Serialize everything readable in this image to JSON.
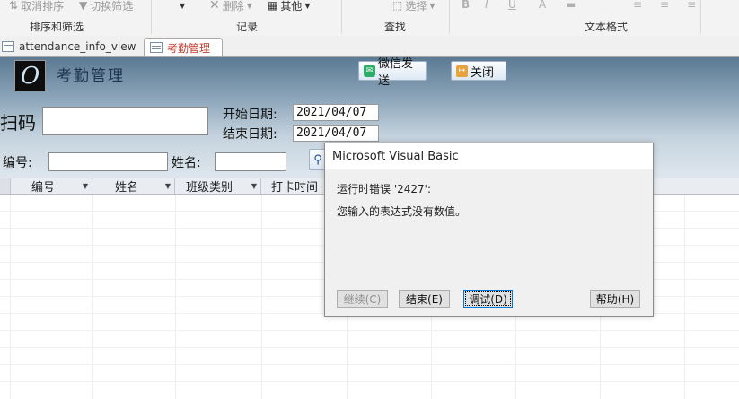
{
  "ribbon": {
    "sort_filter": {
      "cancel_sort": "取消排序",
      "toggle_filter": "切换筛选",
      "group_label": "排序和筛选"
    },
    "records": {
      "delete": "删除",
      "other": "其他",
      "group_label": "记录"
    },
    "find": {
      "select": "选择",
      "group_label": "查找"
    },
    "text_format": {
      "bold": "B",
      "italic": "I",
      "underline": "U",
      "group_label": "文本格式"
    }
  },
  "tabs": [
    {
      "label": "attendance_info_view",
      "active": false,
      "icon": "table-icon"
    },
    {
      "label": "考勤管理",
      "active": true,
      "icon": "form-icon"
    }
  ],
  "form": {
    "title": "考勤管理",
    "logo_letter": "O",
    "wechat_button": "微信发送",
    "close_button": "关闭",
    "scan_label": "扫码",
    "scan_value": "",
    "start_date_label": "开始日期:",
    "start_date_value": "2021/04/07",
    "end_date_label": "结束日期:",
    "end_date_value": "2021/04/07",
    "id_label": "编号:",
    "id_value": "",
    "name_label": "姓名:",
    "name_value": "",
    "search_icon": "search-icon"
  },
  "grid": {
    "columns": [
      "编号",
      "姓名",
      "班级类别",
      "打卡时间"
    ]
  },
  "dialog": {
    "title": "Microsoft Visual Basic",
    "error_line": "运行时错误 '2427':",
    "message": "您输入的表达式没有数值。",
    "buttons": {
      "continue": "继续(C)",
      "end": "结束(E)",
      "debug": "调试(D)",
      "help": "帮助(H)"
    }
  },
  "colors": {
    "form_gradient_top": "#5b7a93",
    "accent_tab": "#c0392b",
    "dialog_bg": "#f0f0f0"
  }
}
